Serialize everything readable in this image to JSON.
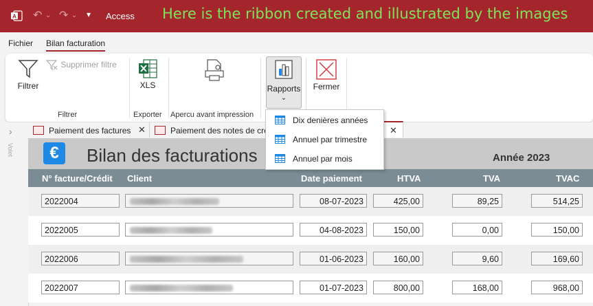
{
  "titlebar": {
    "app_name": "Access",
    "annotation": "Here is the ribbon created and illustrated by the images"
  },
  "menu": {
    "tabs": [
      "Fichier",
      "Bilan facturation"
    ]
  },
  "ribbon": {
    "filtrer": "Filtrer",
    "supprimer_filtre": "Supprimer filtre",
    "xls": "XLS",
    "rapports": "Rapports",
    "fermer": "Fermer",
    "groups": [
      "Filtrer",
      "Exporter",
      "Apercu avant impression"
    ]
  },
  "rapports_menu": {
    "items": [
      "Dix denières années",
      "Annuel par trimestre",
      "Annuel par mois"
    ]
  },
  "nav_pane": {
    "label": "Volet"
  },
  "doc_tabs": [
    {
      "label": "Paiement des factures"
    },
    {
      "label": "Paiement des notes de cré"
    },
    {
      "label": ""
    }
  ],
  "form": {
    "title": "Bilan des facturations",
    "year_label": "Année 2023",
    "columns": [
      "N° facture/Crédit",
      "Client",
      "Date paiement",
      "HTVA",
      "TVA",
      "TVAC"
    ],
    "rows": [
      {
        "num": "2022004",
        "date": "08-07-2023",
        "htva": "425,00",
        "tva": "89,25",
        "tvac": "514,25"
      },
      {
        "num": "2022005",
        "date": "04-08-2023",
        "htva": "150,00",
        "tva": "0,00",
        "tvac": "150,00"
      },
      {
        "num": "2022006",
        "date": "01-06-2023",
        "htva": "160,00",
        "tva": "9,60",
        "tvac": "169,60"
      },
      {
        "num": "2022007",
        "date": "01-07-2023",
        "htva": "800,00",
        "tva": "168,00",
        "tvac": "968,00"
      }
    ]
  },
  "colors": {
    "accent": "#a4262c",
    "annotation": "#7ee35a",
    "header": "#7b8c95",
    "euro": "#1e88e5"
  }
}
